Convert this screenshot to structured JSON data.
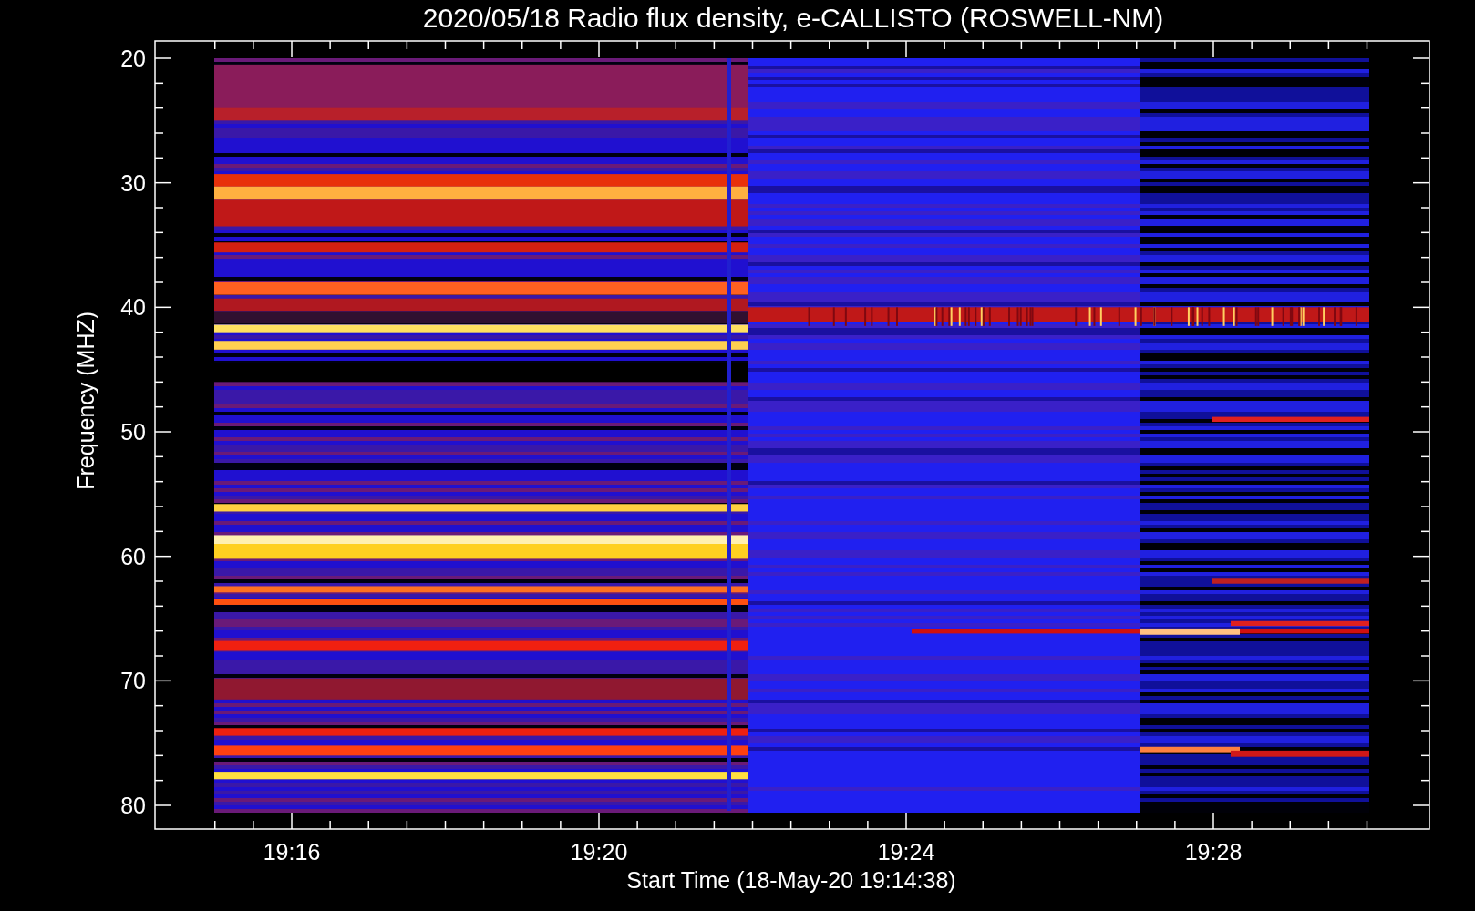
{
  "title": "2020/05/18  Radio flux density, e-CALLISTO (ROSWELL-NM)",
  "y_axis": {
    "label": "Frequency (MHZ)",
    "ticks": [
      "20",
      "30",
      "40",
      "50",
      "60",
      "70",
      "80"
    ]
  },
  "x_axis": {
    "label": "Start Time (18-May-20 19:14:38)",
    "ticks": [
      "19:16",
      "19:20",
      "19:24",
      "19:28"
    ]
  }
}
